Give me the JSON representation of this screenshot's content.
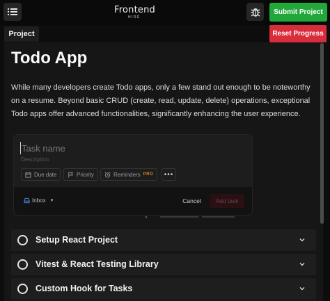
{
  "header": {
    "logo_main": "Frontend",
    "logo_sub": "HIRE",
    "submit_label": "Submit Project",
    "menu_icon": "menu-icon",
    "bug_icon": "bug-icon"
  },
  "toolbar": {
    "project_tab": "Project",
    "reset_label": "Reset Progress"
  },
  "main": {
    "title": "Todo App",
    "description": "While many developers create Todo apps, only a few stand out enough to be noteworthy on a resume. Beyond basic CRUD (create, read, update, delete) operations, exceptional Todo apps offer advanced functionalities, significantly enhancing the user experience."
  },
  "todo_form": {
    "task_name_placeholder": "Task name",
    "description_placeholder": "Description",
    "chips": {
      "due_date": "Due date",
      "priority": "Priority",
      "reminders": "Reminders",
      "pro_badge": "PRO",
      "more": "•••"
    },
    "inbox_label": "Inbox",
    "cancel_label": "Cancel",
    "add_task_label": "Add task"
  },
  "accordion": [
    {
      "label": "Setup React Project"
    },
    {
      "label": "Vitest & React Testing Library"
    },
    {
      "label": "Custom Hook for Tasks"
    }
  ],
  "colors": {
    "submit": "#22a83a",
    "reset": "#d92d3c",
    "pro": "#e0891a"
  }
}
